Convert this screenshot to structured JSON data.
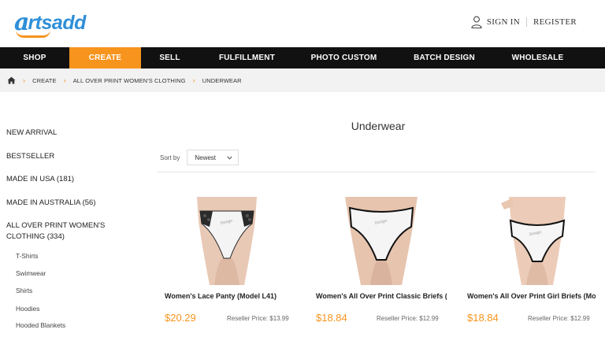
{
  "header": {
    "logo_mark": "a",
    "logo_text": "rtsadd",
    "sign_in": "SIGN IN",
    "register": "REGISTER"
  },
  "nav": {
    "items": [
      "SHOP",
      "CREATE",
      "SELL",
      "FULFILLMENT",
      "PHOTO CUSTOM",
      "BATCH DESIGN",
      "WHOLESALE"
    ],
    "active": "CREATE"
  },
  "breadcrumb": [
    "CREATE",
    "ALL OVER PRINT WOMEN'S CLOTHING",
    "UNDERWEAR"
  ],
  "sidebar": {
    "items": [
      {
        "label": "NEW ARRIVAL"
      },
      {
        "label": "BESTSELLER"
      },
      {
        "label": "MADE IN USA (181)"
      },
      {
        "label": "MADE IN AUSTRALIA (56)"
      },
      {
        "label": "ALL OVER PRINT WOMEN'S CLOTHING (334)"
      }
    ],
    "subitems": [
      "T-Shirts",
      "Swimwear",
      "Shirts",
      "Hoodies",
      "Hooded Blankets"
    ]
  },
  "main": {
    "title": "Underwear",
    "sort_label": "Sort by",
    "sort_value": "Newest"
  },
  "products": [
    {
      "title": "Women's Lace Panty (Model L41)",
      "price": "$20.29",
      "reseller": "Reseller Price: $13.99"
    },
    {
      "title": "Women's All Over Print Classic Briefs (M",
      "price": "$18.84",
      "reseller": "Reseller Price: $12.99"
    },
    {
      "title": "Women's All Over Print Girl Briefs (Mode",
      "price": "$18.84",
      "reseller": "Reseller Price: $12.99"
    }
  ],
  "colors": {
    "brand_blue": "#2f8fd8",
    "accent_orange": "#f7941d",
    "nav_bg": "#111111"
  }
}
